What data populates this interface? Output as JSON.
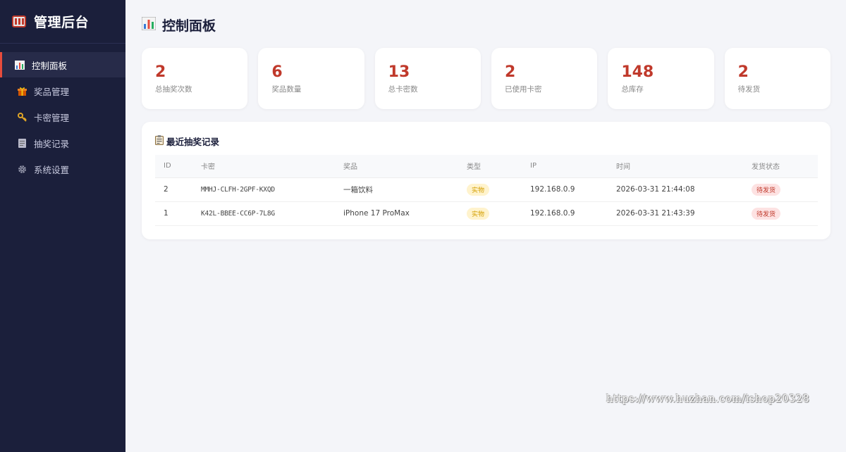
{
  "colors": {
    "sidebar_bg": "#1b1f3b",
    "accent": "#c0392b",
    "active_border": "#e74c3c",
    "page_bg": "#f4f5f9"
  },
  "sidebar": {
    "brand_title": "管理后台",
    "brand_icon": "slot-machine-icon",
    "items": [
      {
        "label": "控制面板",
        "icon": "bar-chart-icon",
        "active": true
      },
      {
        "label": "奖品管理",
        "icon": "gift-icon",
        "active": false
      },
      {
        "label": "卡密管理",
        "icon": "key-icon",
        "active": false
      },
      {
        "label": "抽奖记录",
        "icon": "document-icon",
        "active": false
      },
      {
        "label": "系统设置",
        "icon": "gear-icon",
        "active": false
      }
    ]
  },
  "header": {
    "title": "控制面板",
    "icon": "bar-chart-icon"
  },
  "stats": [
    {
      "value": "2",
      "label": "总抽奖次数"
    },
    {
      "value": "6",
      "label": "奖品数量"
    },
    {
      "value": "13",
      "label": "总卡密数"
    },
    {
      "value": "2",
      "label": "已使用卡密"
    },
    {
      "value": "148",
      "label": "总库存"
    },
    {
      "value": "2",
      "label": "待发货"
    }
  ],
  "recent": {
    "title": "最近抽奖记录",
    "icon": "clipboard-icon",
    "columns": [
      "ID",
      "卡密",
      "奖品",
      "类型",
      "IP",
      "时间",
      "发货状态"
    ],
    "rows": [
      {
        "id": "2",
        "card": "MMHJ-CLFH-2GPF-KXQD",
        "prize": "一箱饮料",
        "type": "实物",
        "ip": "192.168.0.9",
        "time": "2026-03-31 21:44:08",
        "status": "待发货"
      },
      {
        "id": "1",
        "card": "K42L-BBEE-CC6P-7L8G",
        "prize": "iPhone 17 ProMax",
        "type": "实物",
        "ip": "192.168.0.9",
        "time": "2026-03-31 21:43:39",
        "status": "待发货"
      }
    ]
  },
  "watermark": "https://www.huzhan.com/ishop20328"
}
